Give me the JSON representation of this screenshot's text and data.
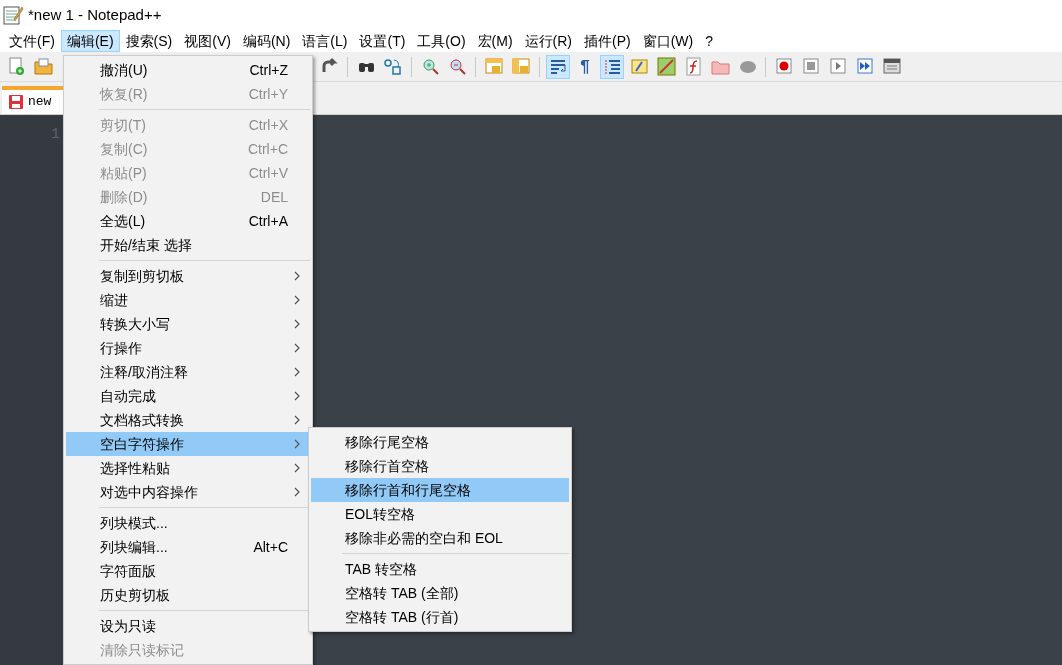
{
  "window": {
    "title": "*new 1 - Notepad++"
  },
  "menubar": [
    {
      "label": "文件(F)",
      "selected": false
    },
    {
      "label": "编辑(E)",
      "selected": true
    },
    {
      "label": "搜索(S)",
      "selected": false
    },
    {
      "label": "视图(V)",
      "selected": false
    },
    {
      "label": "编码(N)",
      "selected": false
    },
    {
      "label": "语言(L)",
      "selected": false
    },
    {
      "label": "设置(T)",
      "selected": false
    },
    {
      "label": "工具(O)",
      "selected": false
    },
    {
      "label": "宏(M)",
      "selected": false
    },
    {
      "label": "运行(R)",
      "selected": false
    },
    {
      "label": "插件(P)",
      "selected": false
    },
    {
      "label": "窗口(W)",
      "selected": false
    },
    {
      "label": "?",
      "selected": false
    }
  ],
  "toolbar_left": [
    {
      "kind": "new",
      "pressed": false
    },
    {
      "kind": "open",
      "pressed": false
    }
  ],
  "toolbar_right": [
    {
      "kind": "redo",
      "pressed": false
    },
    {
      "kind": "sep"
    },
    {
      "kind": "find",
      "pressed": false
    },
    {
      "kind": "replace",
      "pressed": false
    },
    {
      "kind": "sep"
    },
    {
      "kind": "zoomin",
      "pressed": false
    },
    {
      "kind": "zoomout",
      "pressed": false
    },
    {
      "kind": "sep"
    },
    {
      "kind": "syncv",
      "pressed": false
    },
    {
      "kind": "synch",
      "pressed": false
    },
    {
      "kind": "sep"
    },
    {
      "kind": "wrap",
      "pressed": true
    },
    {
      "kind": "pilcrow",
      "label": "¶",
      "pressed": false
    },
    {
      "kind": "indent",
      "pressed": true
    },
    {
      "kind": "lang",
      "pressed": false
    },
    {
      "kind": "map",
      "pressed": false
    },
    {
      "kind": "func",
      "pressed": false
    },
    {
      "kind": "folder",
      "pressed": false
    },
    {
      "kind": "bubble",
      "pressed": false
    },
    {
      "kind": "sep"
    },
    {
      "kind": "record",
      "pressed": false
    },
    {
      "kind": "stop",
      "pressed": false
    },
    {
      "kind": "play",
      "pressed": false
    },
    {
      "kind": "playmulti",
      "pressed": false
    },
    {
      "kind": "savemacro",
      "pressed": false
    }
  ],
  "tab": {
    "label": "new"
  },
  "editor": {
    "line_numbers": [
      "1"
    ]
  },
  "menu": [
    {
      "kind": "item",
      "label": "撤消(U)",
      "shortcut": "Ctrl+Z",
      "disabled": false,
      "submenu": false,
      "selected": false
    },
    {
      "kind": "item",
      "label": "恢复(R)",
      "shortcut": "Ctrl+Y",
      "disabled": true,
      "submenu": false,
      "selected": false
    },
    {
      "kind": "separator"
    },
    {
      "kind": "item",
      "label": "剪切(T)",
      "shortcut": "Ctrl+X",
      "disabled": true,
      "submenu": false,
      "selected": false
    },
    {
      "kind": "item",
      "label": "复制(C)",
      "shortcut": "Ctrl+C",
      "disabled": true,
      "submenu": false,
      "selected": false
    },
    {
      "kind": "item",
      "label": "粘贴(P)",
      "shortcut": "Ctrl+V",
      "disabled": true,
      "submenu": false,
      "selected": false
    },
    {
      "kind": "item",
      "label": "删除(D)",
      "shortcut": "DEL",
      "disabled": true,
      "submenu": false,
      "selected": false
    },
    {
      "kind": "item",
      "label": "全选(L)",
      "shortcut": "Ctrl+A",
      "disabled": false,
      "submenu": false,
      "selected": false
    },
    {
      "kind": "item",
      "label": "开始/结束 选择",
      "disabled": false,
      "submenu": false,
      "selected": false
    },
    {
      "kind": "separator"
    },
    {
      "kind": "item",
      "label": "复制到剪切板",
      "disabled": false,
      "submenu": true,
      "selected": false
    },
    {
      "kind": "item",
      "label": "缩进",
      "disabled": false,
      "submenu": true,
      "selected": false
    },
    {
      "kind": "item",
      "label": "转换大小写",
      "disabled": false,
      "submenu": true,
      "selected": false
    },
    {
      "kind": "item",
      "label": "行操作",
      "disabled": false,
      "submenu": true,
      "selected": false
    },
    {
      "kind": "item",
      "label": "注释/取消注释",
      "disabled": false,
      "submenu": true,
      "selected": false
    },
    {
      "kind": "item",
      "label": "自动完成",
      "disabled": false,
      "submenu": true,
      "selected": false
    },
    {
      "kind": "item",
      "label": "文档格式转换",
      "disabled": false,
      "submenu": true,
      "selected": false
    },
    {
      "kind": "item",
      "label": "空白字符操作",
      "disabled": false,
      "submenu": true,
      "selected": true
    },
    {
      "kind": "item",
      "label": "选择性粘贴",
      "disabled": false,
      "submenu": true,
      "selected": false
    },
    {
      "kind": "item",
      "label": "对选中内容操作",
      "disabled": false,
      "submenu": true,
      "selected": false
    },
    {
      "kind": "separator"
    },
    {
      "kind": "item",
      "label": "列块模式...",
      "disabled": false,
      "submenu": false,
      "selected": false
    },
    {
      "kind": "item",
      "label": "列块编辑...",
      "shortcut": "Alt+C",
      "disabled": false,
      "submenu": false,
      "selected": false
    },
    {
      "kind": "item",
      "label": "字符面版",
      "disabled": false,
      "submenu": false,
      "selected": false
    },
    {
      "kind": "item",
      "label": "历史剪切板",
      "disabled": false,
      "submenu": false,
      "selected": false
    },
    {
      "kind": "separator"
    },
    {
      "kind": "item",
      "label": "设为只读",
      "disabled": false,
      "submenu": false,
      "selected": false
    },
    {
      "kind": "item",
      "label": "清除只读标记",
      "disabled": true,
      "submenu": false,
      "selected": false
    }
  ],
  "submenu": [
    {
      "kind": "item",
      "label": "移除行尾空格",
      "selected": false
    },
    {
      "kind": "item",
      "label": "移除行首空格",
      "selected": false
    },
    {
      "kind": "item",
      "label": "移除行首和行尾空格",
      "selected": true
    },
    {
      "kind": "item",
      "label": "EOL转空格",
      "selected": false
    },
    {
      "kind": "item",
      "label": "移除非必需的空白和 EOL",
      "selected": false
    },
    {
      "kind": "separator"
    },
    {
      "kind": "item",
      "label": "TAB 转空格",
      "selected": false
    },
    {
      "kind": "item",
      "label": "空格转 TAB (全部)",
      "selected": false
    },
    {
      "kind": "item",
      "label": "空格转 TAB (行首)",
      "selected": false
    }
  ]
}
